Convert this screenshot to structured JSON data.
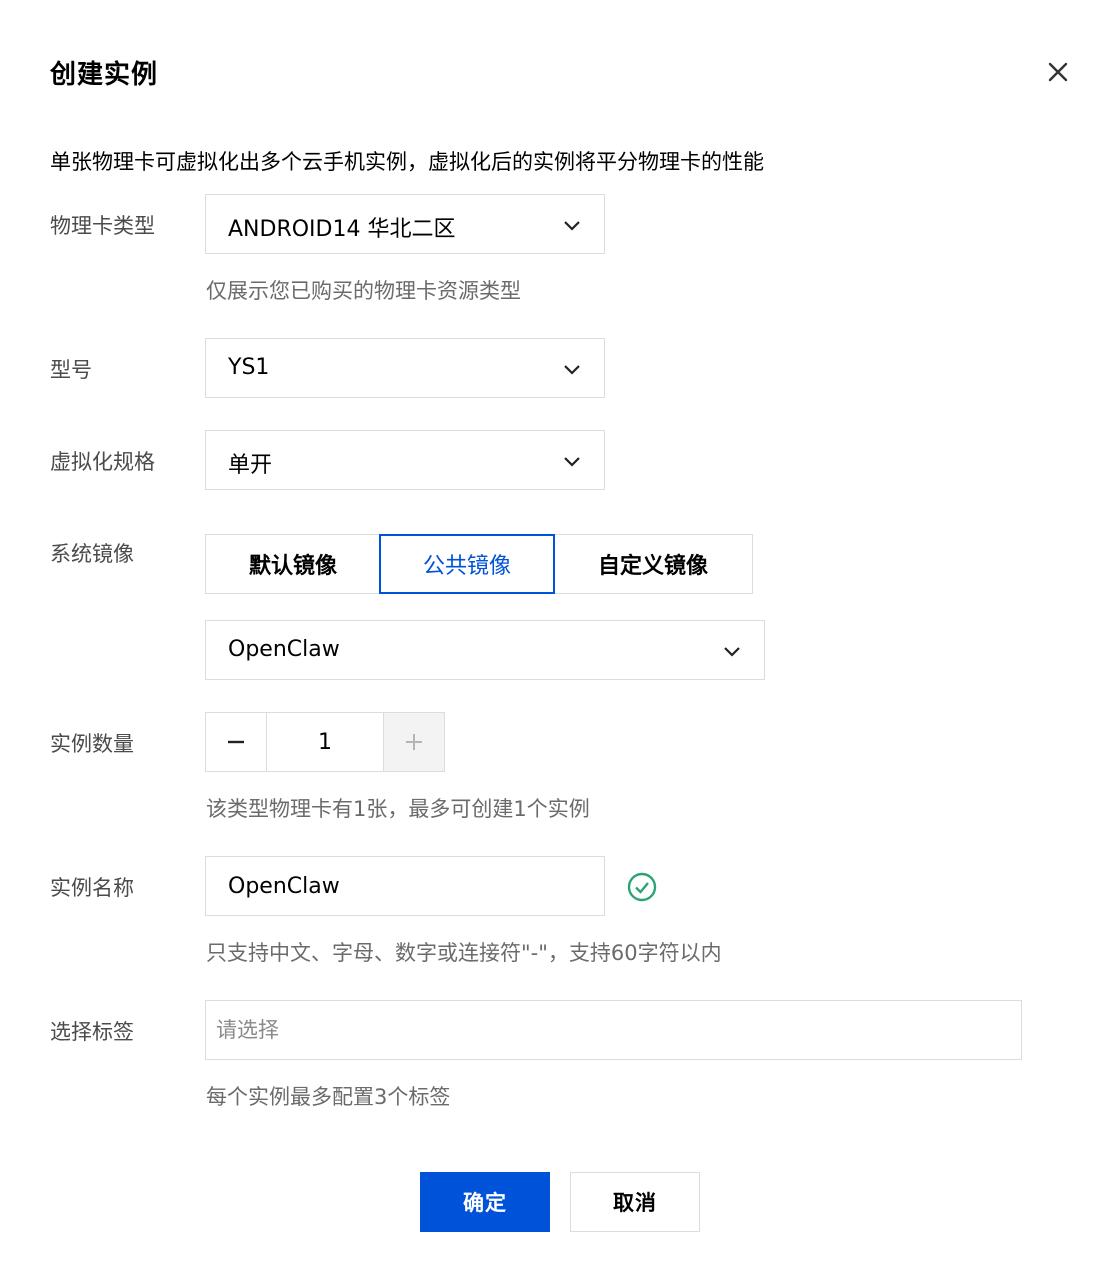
{
  "dialog": {
    "title": "创建实例",
    "intro": "单张物理卡可虚拟化出多个云手机实例，虚拟化后的实例将平分物理卡的性能"
  },
  "card_type": {
    "label": "物理卡类型",
    "value": "ANDROID14 华北二区",
    "hint": "仅展示您已购买的物理卡资源类型"
  },
  "model": {
    "label": "型号",
    "value": "YS1"
  },
  "virt_spec": {
    "label": "虚拟化规格",
    "value": "单开"
  },
  "system_image": {
    "label": "系统镜像",
    "tabs": [
      {
        "label": "默认镜像",
        "active": false
      },
      {
        "label": "公共镜像",
        "active": true
      },
      {
        "label": "自定义镜像",
        "active": false
      }
    ],
    "selected": "OpenClaw"
  },
  "instance_count": {
    "label": "实例数量",
    "value": "1",
    "hint": "该类型物理卡有1张，最多可创建1个实例"
  },
  "instance_name": {
    "label": "实例名称",
    "value": "OpenClaw",
    "hint": "只支持中文、字母、数字或连接符\"-\"，支持60字符以内"
  },
  "tags": {
    "label": "选择标签",
    "placeholder": "请选择",
    "hint": "每个实例最多配置3个标签"
  },
  "footer": {
    "confirm": "确定",
    "cancel": "取消"
  },
  "colors": {
    "primary": "#0052d9",
    "success": "#2ba471",
    "border": "#dcdcdc"
  }
}
